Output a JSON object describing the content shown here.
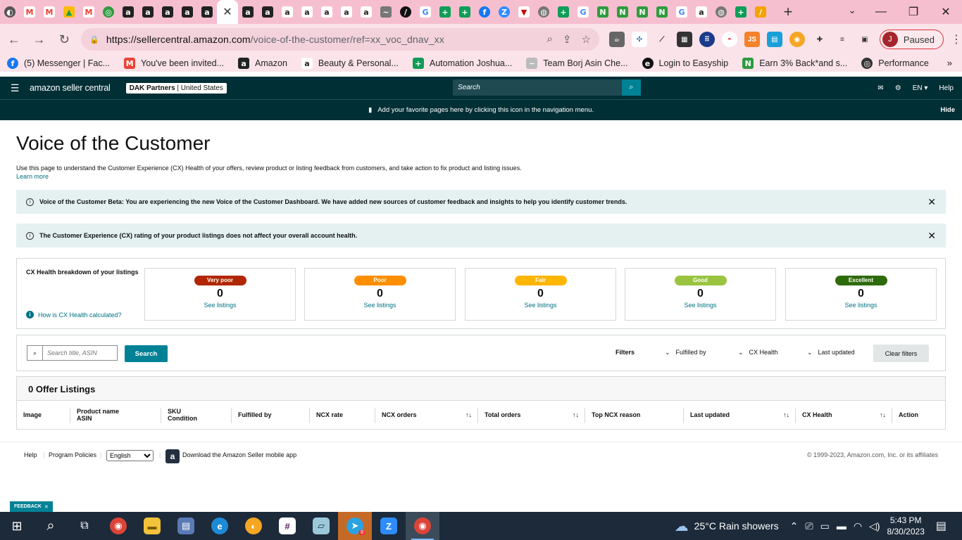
{
  "browser": {
    "tabs_active_close": "✕",
    "new_tab": "+",
    "url_host": "https://sellercentral.amazon.com",
    "url_path": "/voice-of-the-customer/ref=xx_voc_dnav_xx",
    "profile_initial": "J",
    "profile_status": "Paused",
    "bookmarks": [
      {
        "label": "(5) Messenger | Fac...",
        "icon": "messenger-icon",
        "color": "#1877f2",
        "glyph": "f"
      },
      {
        "label": "You've been invited...",
        "icon": "gmail-icon",
        "color": "#ea4335",
        "glyph": "M"
      },
      {
        "label": "Amazon",
        "icon": "amazon-icon",
        "color": "#222222",
        "glyph": "a"
      },
      {
        "label": "Beauty & Personal...",
        "icon": "amazon-icon",
        "color": "#ffffff",
        "glyph": "a"
      },
      {
        "label": "Automation Joshua...",
        "icon": "sheets-icon",
        "color": "#0f9d58",
        "glyph": "+"
      },
      {
        "label": "Team Borj Asin Che...",
        "icon": "team-icon",
        "color": "#bbbbbb",
        "glyph": "~"
      },
      {
        "label": "Login to Easyship",
        "icon": "easyship-icon",
        "color": "#111111",
        "glyph": "e"
      },
      {
        "label": "Earn 3% Back*and s...",
        "icon": "rakuten-icon",
        "color": "#2e9b3e",
        "glyph": "N"
      },
      {
        "label": "Performance",
        "icon": "performance-icon",
        "color": "#333333",
        "glyph": "◎"
      }
    ]
  },
  "seller_header": {
    "logo": "amazon seller central",
    "account_name": "DAK Partners",
    "account_region": "United States",
    "search_placeholder": "Search",
    "language": "EN",
    "help": "Help",
    "favorites_hint": "Add your favorite pages here by clicking this icon in the navigation menu.",
    "hide": "Hide"
  },
  "page": {
    "title": "Voice of the Customer",
    "description": "Use this page to understand the Customer Experience (CX) Health of your offers, review product or listing feedback from customers, and take action to fix product and listing issues.",
    "learn_more": "Learn more",
    "alerts": [
      "Voice of the Customer Beta: You are experiencing the new Voice of the Customer Dashboard. We have added new sources of customer feedback and insights to help you identify customer trends.",
      "The Customer Experience (CX) rating of your product listings does not affect your overall account health."
    ],
    "cx_breakdown_label": "CX Health breakdown of your listings",
    "cx_how": "How is CX Health calculated?",
    "cx_cards": [
      {
        "label": "Very poor",
        "count": "0",
        "link": "See listings",
        "color": "#b12704"
      },
      {
        "label": "Poor",
        "count": "0",
        "link": "See listings",
        "color": "#ff8f00"
      },
      {
        "label": "Fair",
        "count": "0",
        "link": "See listings",
        "color": "#ffb600"
      },
      {
        "label": "Good",
        "count": "0",
        "link": "See listings",
        "color": "#9ac43f"
      },
      {
        "label": "Excellent",
        "count": "0",
        "link": "See listings",
        "color": "#2e6b0a"
      }
    ],
    "search_placeholder": "Search title, ASIN",
    "search_button": "Search",
    "filters_label": "Filters",
    "filters": [
      "Fulfilled by",
      "CX Health",
      "Last updated"
    ],
    "clear_filters": "Clear filters",
    "table_title": "0 Offer Listings",
    "columns": [
      {
        "line1": "Image",
        "line2": ""
      },
      {
        "line1": "Product name",
        "line2": "ASIN"
      },
      {
        "line1": "SKU",
        "line2": "Condition"
      },
      {
        "line1": "Fulfilled by",
        "line2": ""
      },
      {
        "line1": "NCX rate",
        "line2": ""
      },
      {
        "line1": "NCX orders",
        "line2": ""
      },
      {
        "line1": "Total orders",
        "line2": ""
      },
      {
        "line1": "Top NCX reason",
        "line2": ""
      },
      {
        "line1": "Last updated",
        "line2": ""
      },
      {
        "line1": "CX Health",
        "line2": ""
      },
      {
        "line1": "Action",
        "line2": ""
      }
    ],
    "sort_glyph": "↑↓"
  },
  "footer": {
    "help": "Help",
    "policies": "Program Policies",
    "language_selected": "English",
    "app_link": "Download the Amazon Seller mobile app",
    "copyright": "© 1999-2023, Amazon.com, Inc. or its affiliates",
    "feedback": "FEEDBACK"
  },
  "taskbar": {
    "weather": "25°C  Rain showers",
    "time": "5:43 PM",
    "date": "8/30/2023",
    "telegram_badge": "8"
  }
}
